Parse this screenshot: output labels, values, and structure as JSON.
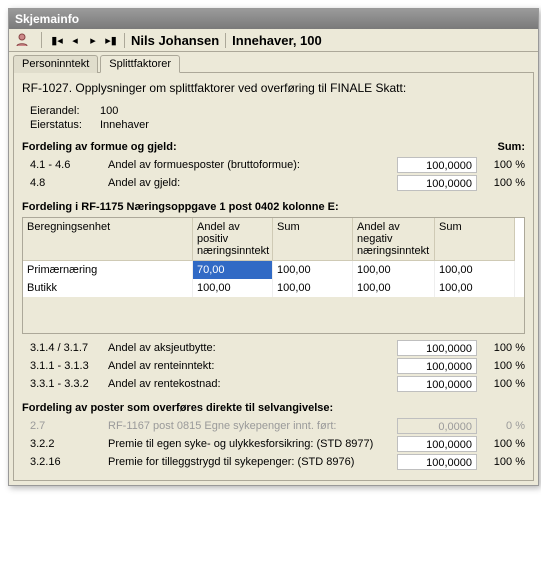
{
  "window": {
    "title": "Skjemainfo"
  },
  "toolbar": {
    "name": "Nils Johansen",
    "role": "Innehaver, 100"
  },
  "tabs": {
    "person": "Personinntekt",
    "splitt": "Splittfaktorer"
  },
  "description": "RF-1027. Opplysninger om splittfaktorer ved overføring til FINALE Skatt:",
  "owner": {
    "share_label": "Eierandel:",
    "share": "100",
    "status_label": "Eierstatus:",
    "status": "Innehaver"
  },
  "section1": {
    "title": "Fordeling av formue og gjeld:",
    "sum_label": "Sum:",
    "rows": [
      {
        "code": "4.1 - 4.6",
        "label": "Andel av formuesposter (bruttoformue):",
        "value": "100,0000",
        "pct": "100 %"
      },
      {
        "code": "4.8",
        "label": "Andel av gjeld:",
        "value": "100,0000",
        "pct": "100 %"
      }
    ]
  },
  "section2": {
    "title": "Fordeling i RF-1175 Næringsoppgave 1 post 0402 kolonne E:",
    "headers": [
      "Beregningsenhet",
      "Andel av positiv næringsinntekt",
      "Sum",
      "Andel av negativ næringsinntekt",
      "Sum"
    ],
    "rows": [
      {
        "name": "Primærnæring",
        "pos": "70,00",
        "sum1": "100,00",
        "neg": "100,00",
        "sum2": "100,00"
      },
      {
        "name": "Butikk",
        "pos": "100,00",
        "sum1": "100,00",
        "neg": "100,00",
        "sum2": "100,00"
      }
    ]
  },
  "section3": {
    "rows": [
      {
        "code": "3.1.4 / 3.1.7",
        "label": "Andel av aksjeutbytte:",
        "value": "100,0000",
        "pct": "100 %"
      },
      {
        "code": "3.1.1 - 3.1.3",
        "label": "Andel av renteinntekt:",
        "value": "100,0000",
        "pct": "100 %"
      },
      {
        "code": "3.3.1 - 3.3.2",
        "label": "Andel av rentekostnad:",
        "value": "100,0000",
        "pct": "100 %"
      }
    ]
  },
  "section4": {
    "title": "Fordeling av poster som overføres direkte til selvangivelse:",
    "rows": [
      {
        "code": "2.7",
        "label": "RF-1167 post 0815 Egne sykepenger innt. ført:",
        "value": "0,0000",
        "pct": "0 %",
        "disabled": true
      },
      {
        "code": "3.2.2",
        "label": "Premie til egen syke- og ulykkesforsikring: (STD 8977)",
        "value": "100,0000",
        "pct": "100 %"
      },
      {
        "code": "3.2.16",
        "label": "Premie for tilleggstrygd til sykepenger: (STD 8976)",
        "value": "100,0000",
        "pct": "100 %"
      }
    ]
  }
}
